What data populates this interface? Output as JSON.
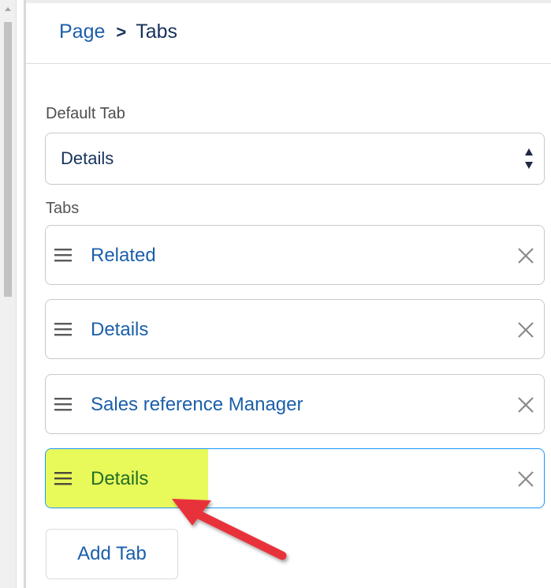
{
  "breadcrumb": {
    "parent": "Page",
    "separator": ">",
    "current": "Tabs"
  },
  "default_tab": {
    "label": "Default Tab",
    "value": "Details"
  },
  "tabs": {
    "label": "Tabs",
    "items": [
      {
        "label": "Related"
      },
      {
        "label": "Details"
      },
      {
        "label": "Sales reference Manager"
      },
      {
        "label": "Details",
        "active": true,
        "highlighted": true
      }
    ]
  },
  "add_tab_label": "Add Tab",
  "colors": {
    "link": "#1b5faa",
    "highlight": "#e8f95a",
    "active_border": "#1b96ff",
    "annotation_arrow": "#e8323a"
  },
  "icons": {
    "drag": "drag-handle-icon",
    "remove": "close-icon",
    "select": "sort-arrows-icon"
  }
}
